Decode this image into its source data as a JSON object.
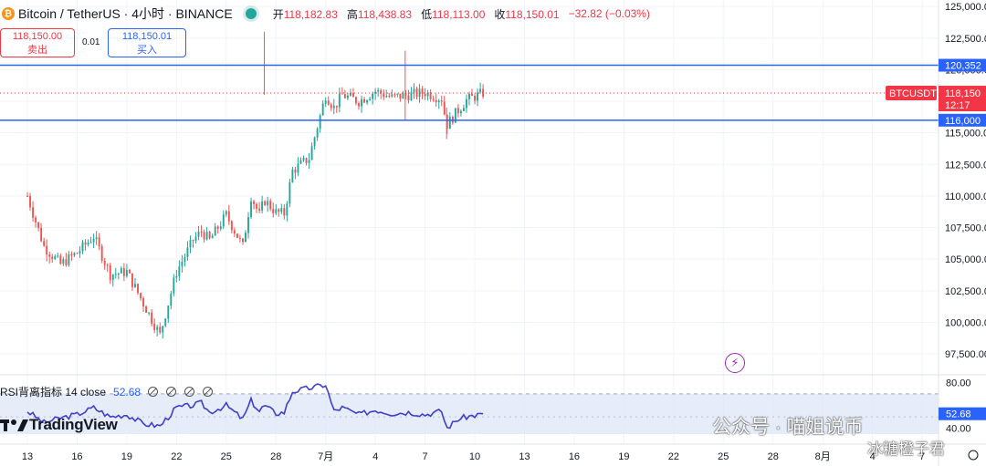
{
  "header": {
    "symbol": "Bitcoin / TetherUS · 4小时 · BINANCE",
    "coin_glyph": "₿",
    "open_label": "开",
    "open": "118,182.83",
    "high_label": "高",
    "high": "118,438.83",
    "low_label": "低",
    "low": "118,113.00",
    "close_label": "收",
    "close": "118,150.01",
    "change": "−32.82 (−0.03%)"
  },
  "trade": {
    "sell_price": "118,150.00",
    "sell_label": "卖出",
    "spread": "0.01",
    "buy_price": "118,150.01",
    "buy_label": "买入"
  },
  "rsi": {
    "label": "RSI背离指标 14 close",
    "value": "52.68"
  },
  "logo": {
    "text": "TradingView"
  },
  "watermark": {
    "line1": "公众号 · 喵姐说币",
    "line2": "冰糖橙子君"
  },
  "colors": {
    "up": "#26a69a",
    "down": "#ef5350",
    "line": "#2962ff",
    "rsi": "#3f3fc8",
    "price": "#f23645"
  },
  "chart_data": [
    {
      "type": "candlestick",
      "symbol": "BTCUSDT",
      "interval": "4小时",
      "ylim": [
        97000,
        125300
      ],
      "price_ticks": [
        "97,500.00",
        "100,000.00",
        "102,500.00",
        "105,000.00",
        "107,500.00",
        "110,000.00",
        "112,500.00",
        "115,000.00",
        "117,500.00",
        "120,000.00",
        "122,500.00",
        "125,000.00"
      ],
      "x_ticks": [
        "13",
        "16",
        "19",
        "22",
        "25",
        "28",
        "7月",
        "4",
        "7",
        "10",
        "13",
        "16",
        "19",
        "22",
        "25",
        "28",
        "8月",
        "4",
        "7"
      ],
      "horizontal_lines": [
        {
          "value": 120352,
          "label": "120,352"
        },
        {
          "value": 116000,
          "label": "116,000"
        }
      ],
      "last_price": {
        "value": 118150,
        "symbol_label": "BTCUSDT",
        "price_label": "118,150",
        "countdown": "12:17"
      },
      "close_path_days": [
        0,
        1,
        2,
        3,
        4,
        5,
        6,
        7,
        8,
        9,
        10,
        10.5,
        11,
        12,
        13,
        13.5,
        14,
        14.3,
        15,
        15.5,
        16,
        17,
        18,
        18.5,
        19,
        20,
        21,
        22,
        23,
        24,
        25,
        25.3,
        26,
        26.5,
        27.5
      ],
      "close_path_values": [
        110000,
        106000,
        104600,
        105500,
        106800,
        103800,
        104000,
        101500,
        99000,
        104000,
        106500,
        107200,
        106500,
        108500,
        106000,
        110000,
        108500,
        109700,
        108700,
        108600,
        112000,
        113000,
        118000,
        117000,
        118000,
        117500,
        118300,
        117800,
        118000,
        118200,
        117700,
        115600,
        116800,
        117600,
        118150
      ]
    },
    {
      "type": "line",
      "name": "RSI",
      "ylim": [
        35,
        85
      ],
      "y_ticks": [
        "80.00",
        "40.00"
      ],
      "band": [
        30,
        70
      ],
      "current": 52.68,
      "x_days": [
        0,
        1,
        2,
        3,
        4,
        5,
        6,
        7,
        8,
        9,
        10,
        10.5,
        11,
        12,
        13,
        13.5,
        14,
        14.3,
        15,
        15.5,
        16,
        17,
        18,
        18.5,
        19,
        20,
        21,
        22,
        23,
        24,
        25,
        25.3,
        26,
        26.5,
        27.5
      ],
      "values": [
        55,
        45,
        49,
        52,
        58,
        50,
        52,
        44,
        42,
        58,
        60,
        62,
        54,
        60,
        48,
        64,
        55,
        60,
        53,
        54,
        72,
        75,
        78,
        55,
        58,
        52,
        56,
        53,
        54,
        52,
        55,
        40,
        48,
        50,
        52.68
      ]
    }
  ]
}
